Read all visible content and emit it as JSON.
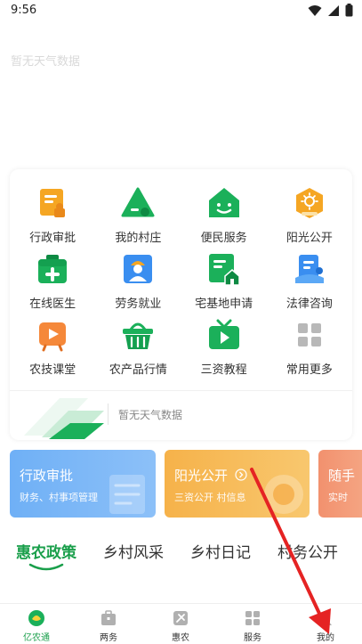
{
  "status_bar": {
    "time": "9:56"
  },
  "weather_top": {
    "text": "暂无天气数据"
  },
  "grid": {
    "items": [
      {
        "label": "行政审批",
        "icon": "admin-approval-icon"
      },
      {
        "label": "我的村庄",
        "icon": "my-village-icon"
      },
      {
        "label": "便民服务",
        "icon": "convenience-service-icon"
      },
      {
        "label": "阳光公开",
        "icon": "sunshine-public-icon"
      },
      {
        "label": "在线医生",
        "icon": "online-doctor-icon"
      },
      {
        "label": "劳务就业",
        "icon": "employment-icon"
      },
      {
        "label": "宅基地申请",
        "icon": "homestead-icon"
      },
      {
        "label": "法律咨询",
        "icon": "legal-consult-icon"
      },
      {
        "label": "农技课堂",
        "icon": "agri-class-icon"
      },
      {
        "label": "农产品行情",
        "icon": "market-basket-icon"
      },
      {
        "label": "三资教程",
        "icon": "tutorial-tv-icon"
      },
      {
        "label": "常用更多",
        "icon": "more-grid-icon"
      }
    ]
  },
  "weather_row": {
    "text": "暂无天气数据"
  },
  "banners": [
    {
      "title": "行政审批",
      "subtitle": "财务、村事项管理"
    },
    {
      "title": "阳光公开",
      "subtitle": "三资公开 村信息"
    },
    {
      "title": "随手",
      "subtitle": "实时"
    }
  ],
  "news_tabs": [
    "惠农政策",
    "乡村风采",
    "乡村日记",
    "村务公开"
  ],
  "bottom_nav": [
    {
      "label": "亿农通",
      "icon": "home-logo-icon",
      "active": true
    },
    {
      "label": "两务",
      "icon": "briefcase-icon"
    },
    {
      "label": "惠农",
      "icon": "farm-icon"
    },
    {
      "label": "服务",
      "icon": "grid-icon"
    },
    {
      "label": "我的",
      "icon": "profile-icon"
    }
  ],
  "colors": {
    "accent": "#1a9f4b",
    "icon_orange": "#f5a623",
    "icon_green": "#1bb05a",
    "icon_blue": "#3a8ef0",
    "icon_gray": "#b8b8b8",
    "annotation": "#e52323"
  }
}
